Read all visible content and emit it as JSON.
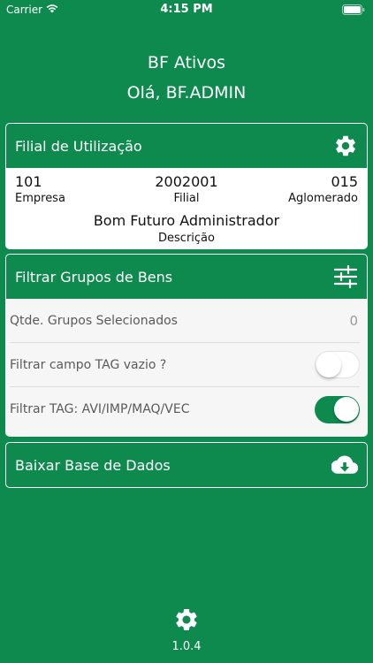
{
  "status_bar": {
    "carrier": "Carrier",
    "time": "4:15 PM"
  },
  "app": {
    "title": "BF Ativos",
    "greeting": "Olá, BF.ADMIN",
    "version": "1.0.4"
  },
  "filial_card": {
    "title": "Filial de Utilização",
    "empresa_value": "101",
    "empresa_label": "Empresa",
    "filial_value": "2002001",
    "filial_label": "Filial",
    "aglomerado_value": "015",
    "aglomerado_label": "Aglomerado",
    "descricao_value": "Bom Futuro Administrador",
    "descricao_label": "Descrição"
  },
  "grupos_card": {
    "title": "Filtrar Grupos de Bens",
    "rows": [
      {
        "label": "Qtde. Grupos Selecionados",
        "value": "0"
      },
      {
        "label": "Filtrar campo TAG vazio ?",
        "toggle": false
      },
      {
        "label": "Filtrar TAG: AVI/IMP/MAQ/VEC",
        "toggle": true
      }
    ]
  },
  "baixar_card": {
    "title": "Baixar Base de Dados"
  },
  "colors": {
    "background": "#0e8a4f",
    "card_body": "#ffffff",
    "toggle_on": "#0e8a4f"
  },
  "icons": [
    "wifi-icon",
    "battery-icon",
    "gear-icon",
    "sliders-icon",
    "cloud-download-icon"
  ]
}
